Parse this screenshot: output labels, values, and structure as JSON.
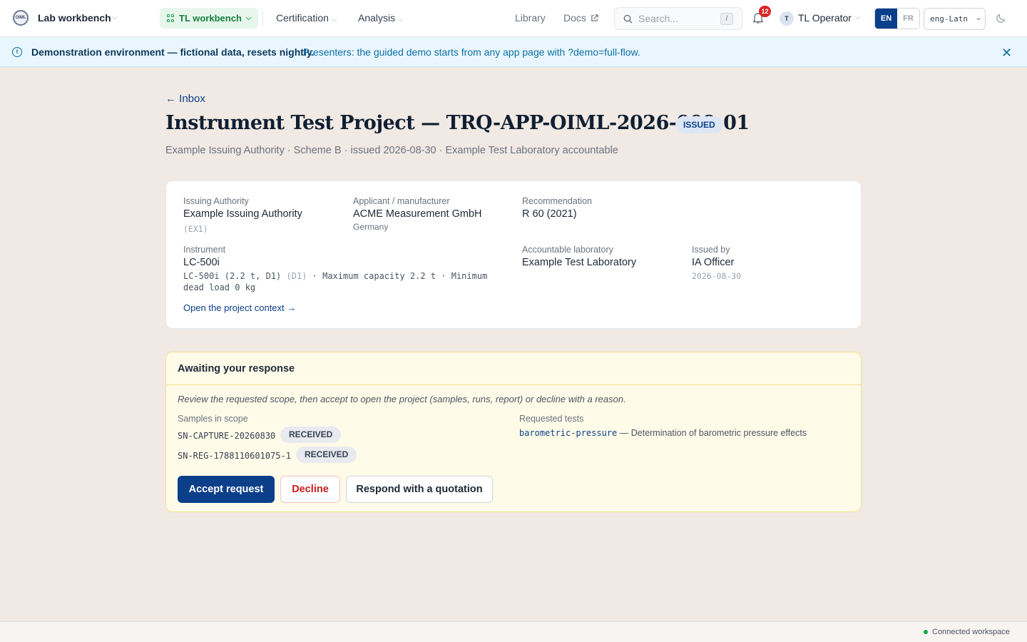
{
  "nav": {
    "logo_text": "OIML",
    "app_name": "Lab workbench",
    "workspace": "TL workbench",
    "links": [
      "Certification",
      "Analysis"
    ],
    "library": "Library",
    "docs": "Docs",
    "search_placeholder": "Search...",
    "search_shortcut": "/",
    "notification_count": "12",
    "user_initial": "T",
    "user_name": "TL Operator",
    "lang_active": "EN",
    "lang_other": "FR",
    "script": "eng-Latn"
  },
  "banner": {
    "title": "Demonstration environment — fictional data, resets nightly.",
    "message": "Presenters: the guided demo starts from any app page with ?demo=full-flow."
  },
  "page": {
    "back": "← Inbox",
    "title": "Instrument Test Project — TRQ-APP-OIML-2026-009-01",
    "status": "ISSUED",
    "subtitle": "Example Issuing Authority · Scheme B · issued 2026-08-30 · Example Test Laboratory accountable"
  },
  "details": {
    "issuing_authority": {
      "label": "Issuing Authority",
      "value": "Example Issuing Authority",
      "code": "(EX1)"
    },
    "applicant": {
      "label": "Applicant / manufacturer",
      "value": "ACME Measurement GmbH",
      "sub": "Germany"
    },
    "recommendation": {
      "label": "Recommendation",
      "value": "R 60 (2021)"
    },
    "instrument": {
      "label": "Instrument",
      "value": "LC-500i",
      "detail_a": "LC-500i (2.2 t, D1)",
      "detail_code": "(D1)",
      "detail_b": "· Maximum capacity 2.2 t · Minimum dead load 0 kg"
    },
    "lab": {
      "label": "Accountable laboratory",
      "value": "Example Test Laboratory"
    },
    "issued_by": {
      "label": "Issued by",
      "value": "IA Officer",
      "date": "2026-08-30"
    },
    "context_link": "Open the project context →"
  },
  "await": {
    "heading": "Awaiting your response",
    "note": "Review the requested scope, then accept to open the project (samples, runs, report) or decline with a reason.",
    "samples_label": "Samples in scope",
    "samples": [
      {
        "id": "SN-CAPTURE-20260830",
        "status": "RECEIVED"
      },
      {
        "id": "SN-REG-1788110601075-1",
        "status": "RECEIVED"
      }
    ],
    "tests_label": "Requested tests",
    "test_code": "barometric-pressure",
    "test_desc": "— Determination of barometric pressure effects",
    "accept": "Accept request",
    "decline": "Decline",
    "quote": "Respond with a quotation"
  },
  "footer": {
    "status": "Connected workspace"
  },
  "colors": {
    "primary": "#0b3f8a",
    "danger": "#c81e1e",
    "success": "#16a34a",
    "banner_bg": "#eaf6fd",
    "await_bg": "#fefbe8"
  }
}
